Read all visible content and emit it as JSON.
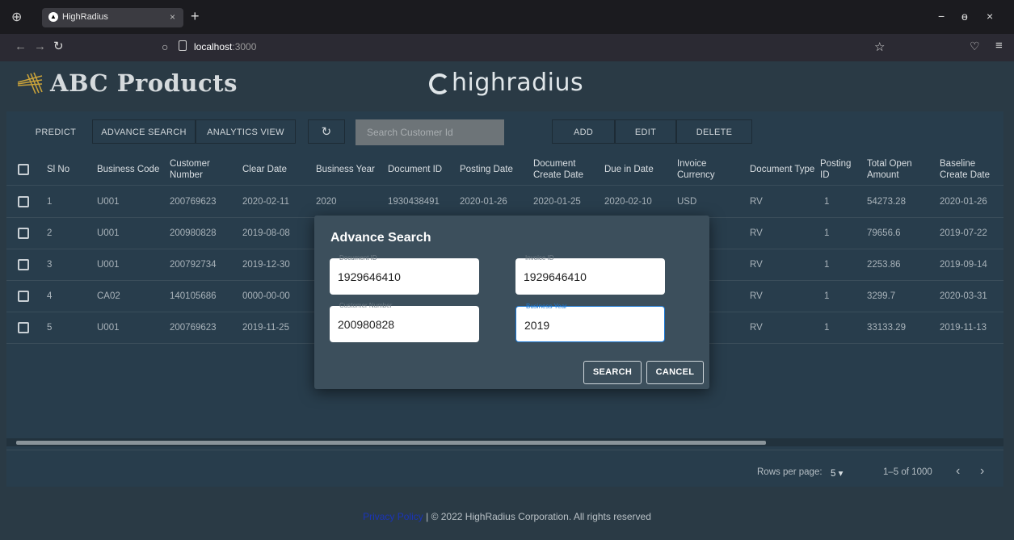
{
  "browser": {
    "tab_title": "HighRadius",
    "tab_close": "×",
    "new_tab": "+",
    "url_host": "localhost",
    "url_port": ":3000",
    "win_min": "−",
    "win_restore": "ɵ",
    "win_close": "×"
  },
  "app": {
    "brand_name": "ABC Products",
    "partner_logo": "highradius"
  },
  "toolbar": {
    "predict": "PREDICT",
    "advance_search": "ADVANCE SEARCH",
    "analytics_view": "ANALYTICS VIEW",
    "refresh_icon": "↻",
    "search_placeholder": "Search Customer Id",
    "add": "ADD",
    "edit": "EDIT",
    "delete": "DELETE"
  },
  "table": {
    "headers": [
      [
        "Sl No",
        ""
      ],
      [
        "Business Code",
        ""
      ],
      [
        "Customer",
        "Number"
      ],
      [
        "Clear Date",
        ""
      ],
      [
        "Business Year",
        ""
      ],
      [
        "Document ID",
        ""
      ],
      [
        "Posting Date",
        ""
      ],
      [
        "Document",
        "Create Date"
      ],
      [
        "Due in Date",
        ""
      ],
      [
        "Invoice",
        "Currency"
      ],
      [
        "Document Type",
        ""
      ],
      [
        "Posting",
        "ID"
      ],
      [
        "Total Open",
        "Amount"
      ],
      [
        "Baseline",
        "Create Date"
      ]
    ],
    "rows": [
      [
        "1",
        "U001",
        "200769623",
        "2020-02-11",
        "2020",
        "1930438491",
        "2020-01-26",
        "2020-01-25",
        "2020-02-10",
        "USD",
        "RV",
        "1",
        "54273.28",
        "2020-01-26"
      ],
      [
        "2",
        "U001",
        "200980828",
        "2019-08-08",
        "",
        "",
        "",
        "",
        "",
        "",
        "RV",
        "1",
        "79656.6",
        "2019-07-22"
      ],
      [
        "3",
        "U001",
        "200792734",
        "2019-12-30",
        "",
        "",
        "",
        "",
        "",
        "",
        "RV",
        "1",
        "2253.86",
        "2019-09-14"
      ],
      [
        "4",
        "CA02",
        "140105686",
        "0000-00-00",
        "",
        "",
        "",
        "",
        "",
        "",
        "RV",
        "1",
        "3299.7",
        "2020-03-31"
      ],
      [
        "5",
        "U001",
        "200769623",
        "2019-11-25",
        "",
        "",
        "",
        "",
        "",
        "",
        "RV",
        "1",
        "33133.29",
        "2019-11-13"
      ]
    ]
  },
  "pagination": {
    "rows_per_page_label": "Rows per page:",
    "rows_per_page_value": "5",
    "range": "1–5 of 1000",
    "prev": "‹",
    "next": "›"
  },
  "modal": {
    "title": "Advance Search",
    "fields": [
      {
        "label": "Document ID",
        "value": "1929646410"
      },
      {
        "label": "Invoice ID",
        "value": "1929646410"
      },
      {
        "label": "Customer Number",
        "value": "200980828"
      },
      {
        "label": "Business Year",
        "value": "2019"
      }
    ],
    "search": "SEARCH",
    "cancel": "CANCEL"
  },
  "footer": {
    "privacy": "Privacy Policy",
    "copyright": "| © 2022 HighRadius Corporation. All rights reserved"
  },
  "colors": {
    "background": "#2a3a45",
    "panel": "#283d4c",
    "modal": "#3c4f5c",
    "link": "#1a34b8",
    "focus": "#1976d2"
  }
}
